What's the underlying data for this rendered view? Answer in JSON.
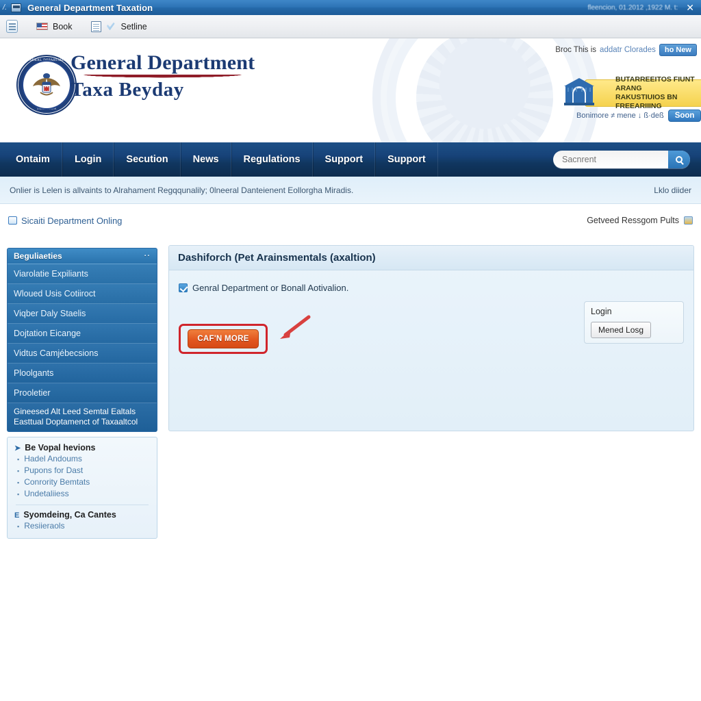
{
  "window": {
    "title": "General Department Taxation",
    "mark": "/.",
    "timestamp": "fleencion, 01.2012 ,1922 M. t:",
    "close_label": "✕"
  },
  "toolbar": {
    "items": [
      {
        "icon": "form-icon",
        "label": ""
      },
      {
        "icon": "flag-icon",
        "label": "Book"
      },
      {
        "icon": "page-icon",
        "label": ""
      },
      {
        "icon": "check-icon",
        "label": "Setline"
      }
    ]
  },
  "header": {
    "logo_line1": "General Department",
    "logo_line2": "Taxa Beyday",
    "seal_top_text": "GENERAL DEPARTMENT",
    "seal_bottom_text": "TAXATION",
    "promo": {
      "lead": "Broc This is",
      "link": "addatr Clorades",
      "pill": "ho New",
      "banner_line1": "BUTARREEITOS FIUNT ARANG",
      "banner_line2": "RAKUSTIUIOS BN FREEARIIING",
      "foot_text": "Bonimore ≠ mene ↓ ß·deß",
      "foot_button": "Soon"
    }
  },
  "nav": {
    "items": [
      "Ontaim",
      "Login",
      "Secution",
      "News",
      "Regulations",
      "Support",
      "Support"
    ],
    "search_placeholder": "Sacnrent",
    "search_value": "",
    "search_icon": "search-icon"
  },
  "info_strip": {
    "text": "Onlier is Lelen is allvaints to Alrahament Regqqunalily; 0lneeral Danteienent Eollorgha Miradis.",
    "right": "Lklo diider"
  },
  "section_row": {
    "left_label": "Sicaiti Department Onling",
    "right_label": "Getveed Ressgom Pults"
  },
  "sidebar": {
    "head": "Beguliaeties",
    "head_toggle": "··",
    "items": [
      "Viarolatie Expiliants",
      "Wloued Usis Cotiiroct",
      "Viqber Daly Staelis",
      "Dojtation Eicange",
      "Vidtus Camjébecsions",
      "Ploolgants",
      "Prooletier"
    ],
    "footer_line1": "Gineesed Alt Leed Semtal Ealtals",
    "footer_line2": "Easttual Doptamenct of Taxaaltcol"
  },
  "linkbox": {
    "group1": {
      "marker": "➤",
      "title": "Be Vopal hevions",
      "items": [
        "Hadel Andoums",
        "Pupons for Dast",
        "Conrority Bemtats",
        "Undetaliiess"
      ]
    },
    "group2": {
      "marker": "E",
      "title": "Syomdeing, Ca Cantes",
      "items": [
        "Resiieraols"
      ]
    }
  },
  "panel": {
    "title": "Dashiforch (Pet Arainsmentals (axaltion)",
    "checkbox_label": "Genral Department or Bonall Aotivalion.",
    "checkbox_checked": true,
    "cta_label": "CAF'N MORE",
    "login": {
      "title": "Login",
      "button": "Mened Losg"
    }
  },
  "colors": {
    "titlebar_blue": "#2d74b6",
    "nav_blue": "#14406f",
    "brand_navy": "#1b3a73",
    "brand_red": "#8f1d28",
    "cta_orange": "#e2571f",
    "highlight_red": "#d0252c",
    "panel_blue": "#e5f1f8",
    "sidebar_blue": "#2a73ad"
  }
}
